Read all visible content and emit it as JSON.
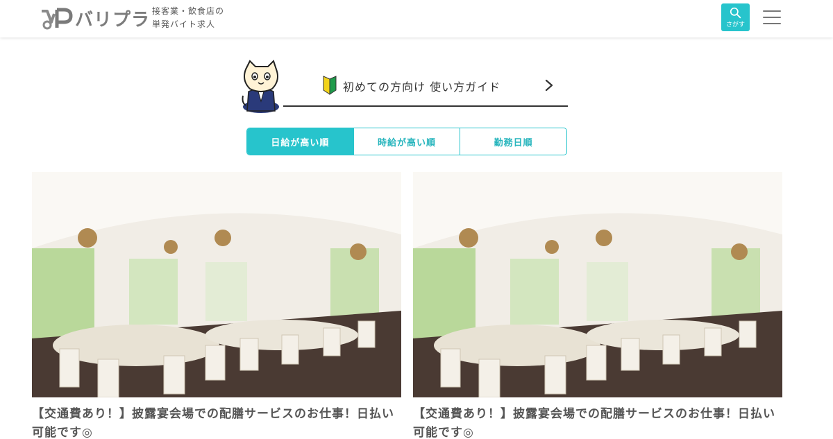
{
  "header": {
    "logo_text": "バリプラ",
    "tagline_line1": "接客業・飲食店の",
    "tagline_line2": "単発バイト求人",
    "search_label": "さがす"
  },
  "guide": {
    "label": "初めての方向け 使い方ガイド"
  },
  "sort": {
    "tabs": [
      {
        "label": "日給が高い順",
        "active": true
      },
      {
        "label": "時給が高い順",
        "active": false
      },
      {
        "label": "勤務日順",
        "active": false
      }
    ]
  },
  "jobs": [
    {
      "title": "【交通費あり！】披露宴会場での配膳サービスのお仕事！日払い可能です◎"
    },
    {
      "title": "【交通費あり！】披露宴会場での配膳サービスのお仕事！日払い可能です◎"
    }
  ],
  "colors": {
    "accent": "#27c4cc",
    "text": "#555555"
  }
}
